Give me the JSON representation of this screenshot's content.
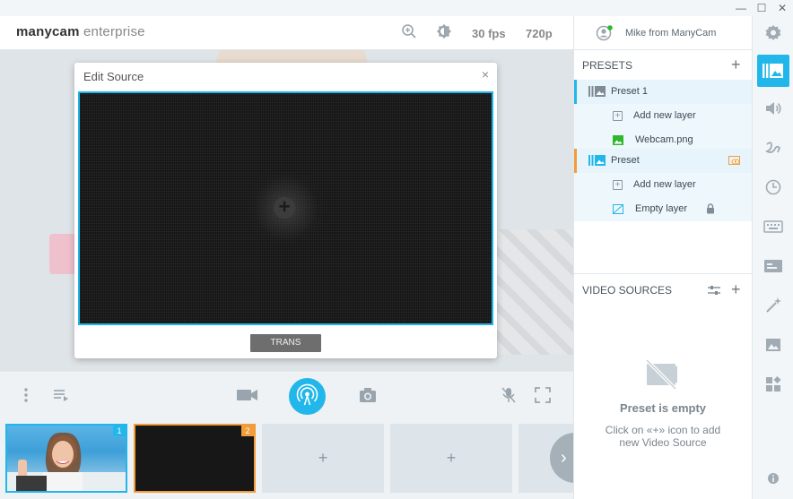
{
  "titlebar": {
    "minimize": "—",
    "maximize": "☐",
    "close": "✕"
  },
  "header": {
    "logo_main": "manycam",
    "logo_sub": "enterprise",
    "fps": "30 fps",
    "resolution": "720p",
    "user": "Mike from ManyCam"
  },
  "modal": {
    "title": "Edit Source",
    "close": "×",
    "add_symbol": "+",
    "trans_label": "TRANS"
  },
  "strip": {
    "slot1_badge": "1",
    "slot2_badge": "2",
    "add_symbol": "+",
    "next_symbol": "›"
  },
  "presets": {
    "title": "PRESETS",
    "add": "+",
    "items": [
      {
        "label": "Preset 1"
      },
      {
        "label": "Add new layer"
      },
      {
        "label": "Webcam.png"
      },
      {
        "label": "Preset"
      },
      {
        "label": "Add new layer"
      },
      {
        "label": "Empty layer"
      }
    ]
  },
  "video_sources": {
    "title": "VIDEO SOURCES",
    "add": "+",
    "empty_title": "Preset is empty",
    "empty_line1": "Click on «+» icon to add",
    "empty_line2": "new Video Source"
  },
  "colors": {
    "accent": "#22b7ea",
    "orange": "#f39c3a",
    "green": "#2eb82e"
  },
  "icons": [
    "zoom-in-icon",
    "brightness-icon",
    "user-icon",
    "gear-icon",
    "presets-icon",
    "volume-icon",
    "draw-icon",
    "clock-icon",
    "keyboard-icon",
    "lower-thirds-icon",
    "effects-icon",
    "image-icon",
    "widgets-icon",
    "info-icon"
  ]
}
